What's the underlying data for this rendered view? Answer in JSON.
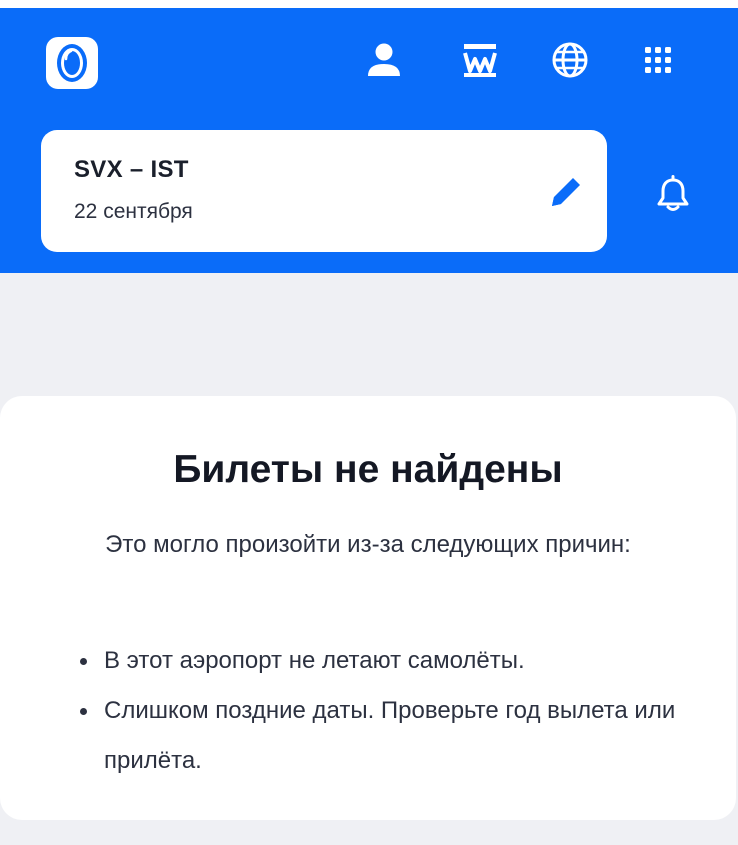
{
  "header": {
    "background": "#0a6cf9",
    "logo_icon": "porthole-logo-icon",
    "icons": [
      "profile-icon",
      "loyalty-icon",
      "globe-icon",
      "apps-grid-icon"
    ]
  },
  "search": {
    "route": "SVX – IST",
    "date": "22 сентября",
    "edit_icon": "pencil-icon",
    "subscribe_icon": "bell-icon"
  },
  "result": {
    "title": "Билеты не найдены",
    "subtitle": "Это могло произойти из-за следующих причин:",
    "reasons": [
      "В этот аэропорт не летают самолёты.",
      "Слишком поздние даты. Проверьте год вылета или прилёта."
    ]
  }
}
